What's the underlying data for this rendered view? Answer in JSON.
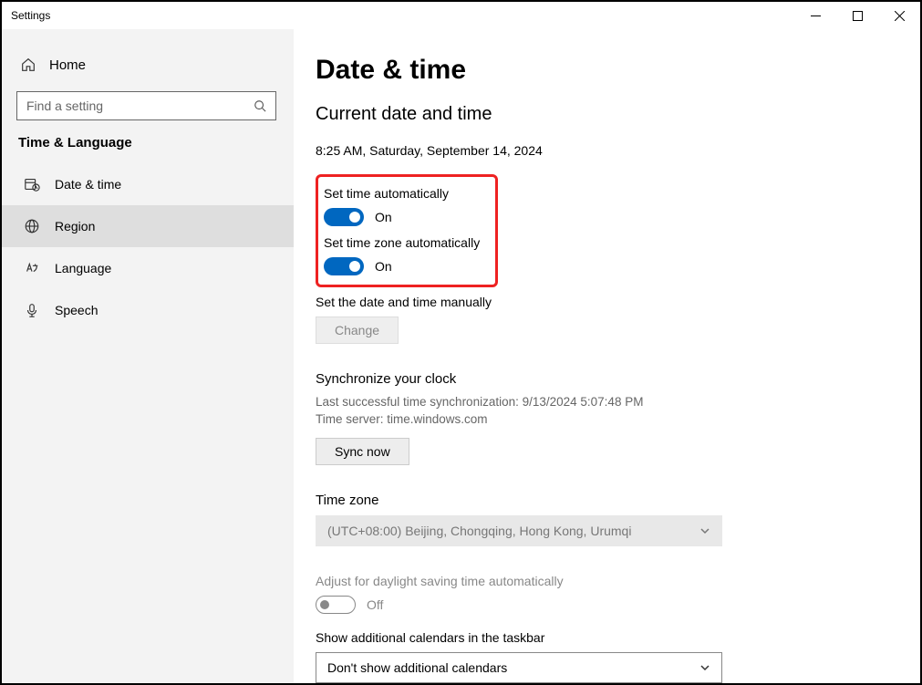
{
  "window": {
    "title": "Settings"
  },
  "sidebar": {
    "home": "Home",
    "search_placeholder": "Find a setting",
    "group_header": "Time & Language",
    "items": [
      {
        "label": "Date & time"
      },
      {
        "label": "Region"
      },
      {
        "label": "Language"
      },
      {
        "label": "Speech"
      }
    ]
  },
  "main": {
    "title": "Date & time",
    "subtitle": "Current date and time",
    "datetime": "8:25 AM, Saturday, September 14, 2024",
    "set_time_auto": {
      "label": "Set time automatically",
      "state": "On"
    },
    "set_tz_auto": {
      "label": "Set time zone automatically",
      "state": "On"
    },
    "manual": {
      "label": "Set the date and time manually",
      "button": "Change"
    },
    "sync": {
      "header": "Synchronize your clock",
      "last": "Last successful time synchronization: 9/13/2024 5:07:48 PM",
      "server": "Time server: time.windows.com",
      "button": "Sync now"
    },
    "timezone": {
      "header": "Time zone",
      "value": "(UTC+08:00) Beijing, Chongqing, Hong Kong, Urumqi"
    },
    "dst": {
      "label": "Adjust for daylight saving time automatically",
      "state": "Off"
    },
    "calendars": {
      "label": "Show additional calendars in the taskbar",
      "value": "Don't show additional calendars"
    }
  }
}
